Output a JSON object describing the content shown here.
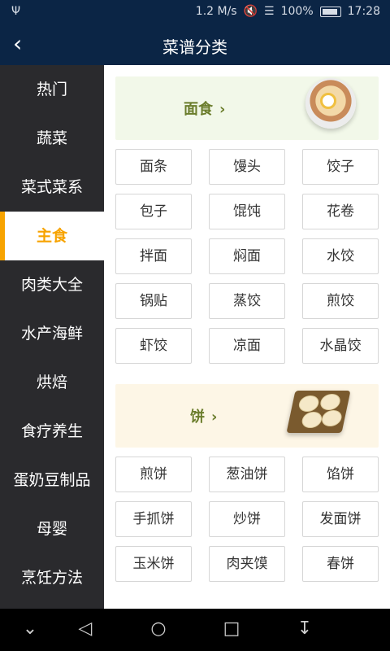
{
  "status": {
    "speed": "1.2 M/s",
    "battery": "100%",
    "time": "17:28"
  },
  "header": {
    "title": "菜谱分类"
  },
  "sidebar": {
    "items": [
      {
        "label": "热门"
      },
      {
        "label": "蔬菜"
      },
      {
        "label": "菜式菜系"
      },
      {
        "label": "主食"
      },
      {
        "label": "肉类大全"
      },
      {
        "label": "水产海鲜"
      },
      {
        "label": "烘焙"
      },
      {
        "label": "食疗养生"
      },
      {
        "label": "蛋奶豆制品"
      },
      {
        "label": "母婴"
      },
      {
        "label": "烹饪方法"
      }
    ],
    "active_index": 3
  },
  "sections": [
    {
      "title": "面食",
      "image_icon": "ramen-bowl",
      "items": [
        "面条",
        "馒头",
        "饺子",
        "包子",
        "馄饨",
        "花卷",
        "拌面",
        "焖面",
        "水饺",
        "锅贴",
        "蒸饺",
        "煎饺",
        "虾饺",
        "凉面",
        "水晶饺"
      ]
    },
    {
      "title": "饼",
      "image_icon": "pancake-plate",
      "items": [
        "煎饼",
        "葱油饼",
        "馅饼",
        "手抓饼",
        "炒饼",
        "发面饼",
        "玉米饼",
        "肉夹馍",
        "春饼"
      ]
    }
  ],
  "colors": {
    "header_bg": "#0b2545",
    "sidebar_bg": "#2a2a2d",
    "accent": "#f7a300",
    "section_label": "#6b7d2c",
    "banner1_bg": "#f2f8e9",
    "banner2_bg": "#fdf6e6"
  }
}
